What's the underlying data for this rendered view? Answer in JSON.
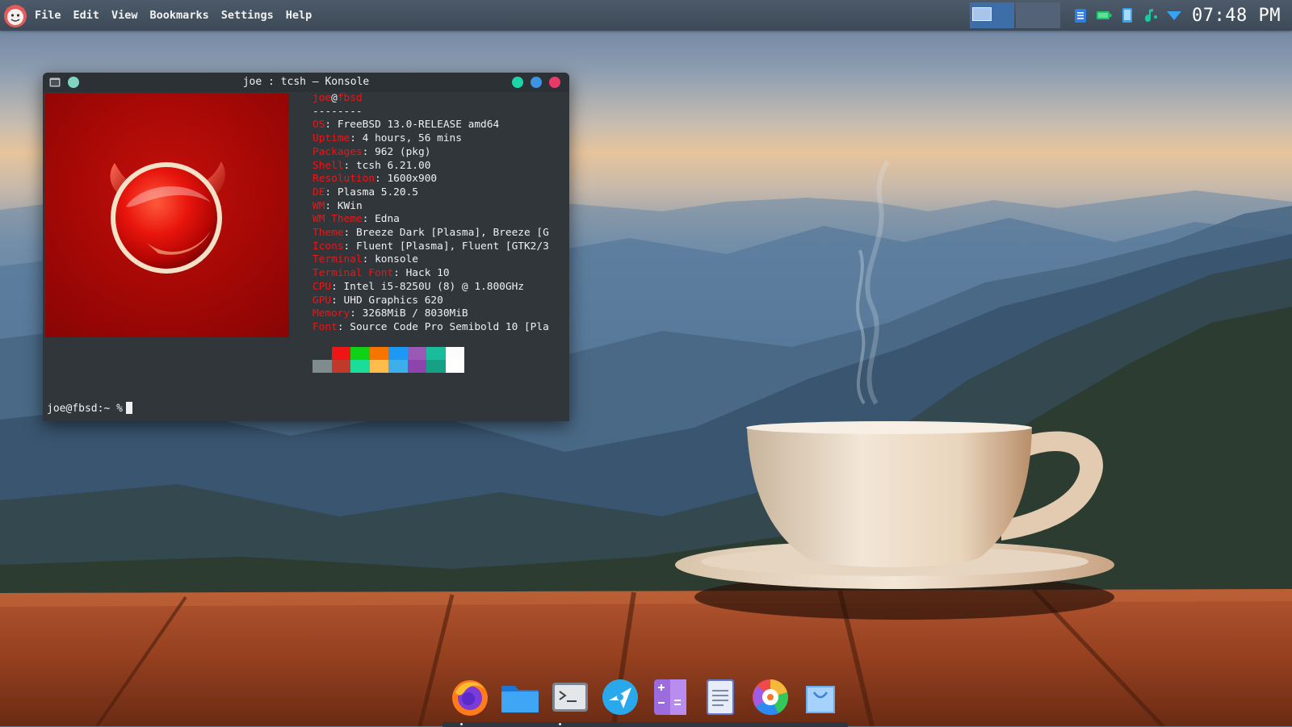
{
  "topbar": {
    "menus": [
      "File",
      "Edit",
      "View",
      "Bookmarks",
      "Settings",
      "Help"
    ],
    "clock": "07:48 PM",
    "tray_icons": [
      "clipboard-icon",
      "battery-icon",
      "kdeconnect-icon",
      "audio-volume-icon",
      "network-icon"
    ]
  },
  "konsole": {
    "title": "joe : tcsh — Konsole",
    "user": "joe",
    "at": "@",
    "host": "fbsd",
    "separator": "--------",
    "info": [
      {
        "key": "OS",
        "value": "FreeBSD 13.0-RELEASE amd64"
      },
      {
        "key": "Uptime",
        "value": "4 hours, 56 mins"
      },
      {
        "key": "Packages",
        "value": "962 (pkg)"
      },
      {
        "key": "Shell",
        "value": "tcsh 6.21.00"
      },
      {
        "key": "Resolution",
        "value": "1600x900"
      },
      {
        "key": "DE",
        "value": "Plasma 5.20.5"
      },
      {
        "key": "WM",
        "value": "KWin"
      },
      {
        "key": "WM Theme",
        "value": "Edna"
      },
      {
        "key": "Theme",
        "value": "Breeze Dark [Plasma], Breeze [G"
      },
      {
        "key": "Icons",
        "value": "Fluent [Plasma], Fluent [GTK2/3"
      },
      {
        "key": "Terminal",
        "value": "konsole"
      },
      {
        "key": "Terminal Font",
        "value": "Hack 10"
      },
      {
        "key": "CPU",
        "value": "Intel i5-8250U (8) @ 1.800GHz"
      },
      {
        "key": "GPU",
        "value": "UHD Graphics 620"
      },
      {
        "key": "Memory",
        "value": "3268MiB / 8030MiB"
      },
      {
        "key": "Font",
        "value": "Source Code Pro Semibold 10 [Pla"
      }
    ],
    "info_sep": ": ",
    "prompt": "joe@fbsd:~ %"
  },
  "palette": {
    "row1": [
      "#31363b",
      "#ed1515",
      "#11d116",
      "#f67400",
      "#1d99f3",
      "#9b59b6",
      "#1abc9c",
      "#fcfcfc"
    ],
    "row2": [
      "#7f8c8d",
      "#c0392b",
      "#1cdc9a",
      "#fdbc4b",
      "#3daee9",
      "#8e44ad",
      "#16a085",
      "#ffffff"
    ]
  },
  "dock": {
    "items": [
      "firefox-icon",
      "file-manager-icon",
      "terminal-icon",
      "discover-icon",
      "calculator-icon",
      "text-editor-icon",
      "color-picker-icon",
      "store-icon"
    ]
  },
  "colors": {
    "accent_red": "#ed1515",
    "panel": "#444f5c",
    "terminal_bg": "#31363b"
  }
}
